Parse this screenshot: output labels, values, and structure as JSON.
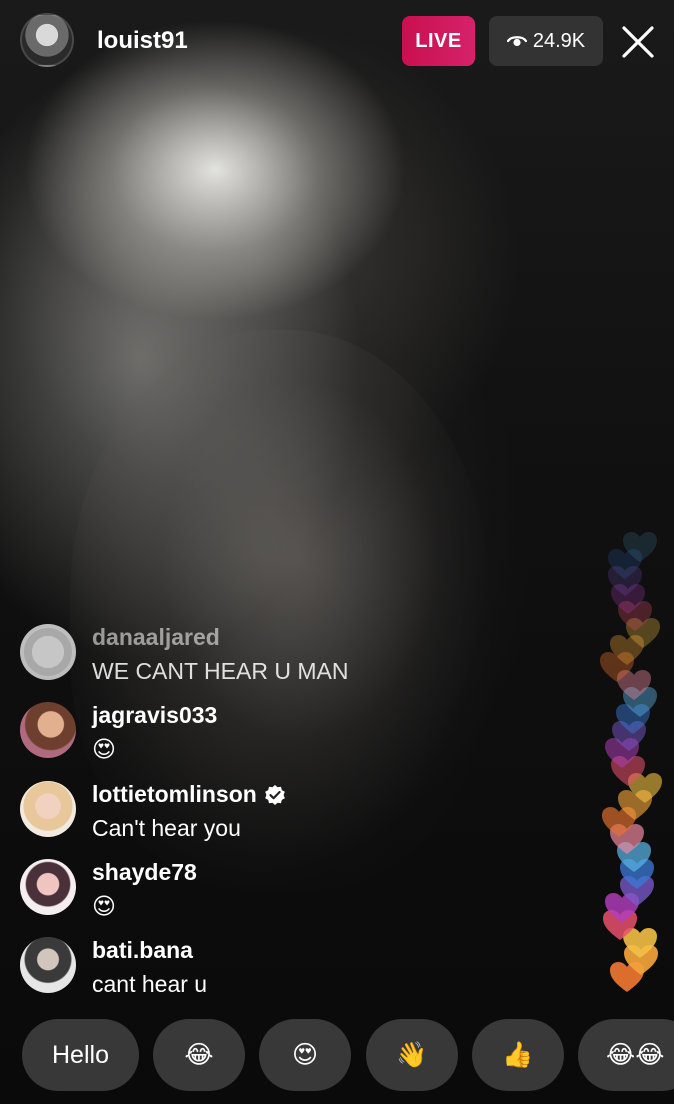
{
  "header": {
    "username": "louist91",
    "live_label": "LIVE",
    "viewer_count": "24.9K"
  },
  "comments": [
    {
      "user": "danaaljared",
      "text": "WE CANT HEAR U MAN",
      "verified": false,
      "faded": true
    },
    {
      "user": "jagravis033",
      "text": "😍",
      "verified": false,
      "faded": false
    },
    {
      "user": "lottietomlinson",
      "text": "Can't hear you",
      "verified": true,
      "faded": false
    },
    {
      "user": "shayde78",
      "text": "😍",
      "verified": false,
      "faded": false
    },
    {
      "user": "bati.bana",
      "text": "cant hear u",
      "verified": false,
      "faded": false
    }
  ],
  "quick_replies": [
    "Hello",
    "😂",
    "😍",
    "👋",
    "👍",
    "😂😂"
  ],
  "colors": {
    "live_badge": "#d01a5a",
    "hearts": [
      "#e8732f",
      "#f2a33a",
      "#f4c145",
      "#e8506c",
      "#b33fbd",
      "#7b59c9",
      "#3a7bd5",
      "#5ab2e6",
      "#f08aa0"
    ]
  }
}
